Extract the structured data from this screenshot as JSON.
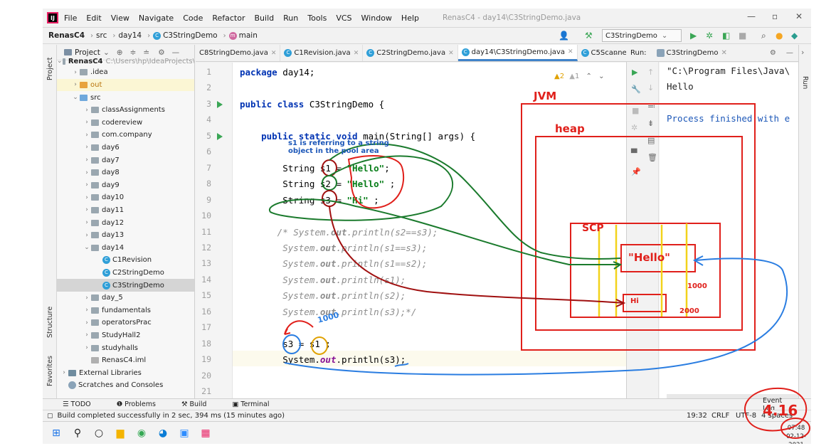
{
  "menu": {
    "items": [
      "File",
      "Edit",
      "View",
      "Navigate",
      "Code",
      "Refactor",
      "Build",
      "Run",
      "Tools",
      "VCS",
      "Window",
      "Help"
    ],
    "window_title": "RenasC4 - day14\\C3StringDemo.java"
  },
  "nav": {
    "project": "RenasC4",
    "crumbs": [
      "src",
      "day14",
      "C3StringDemo",
      "main"
    ],
    "run_config": "C3StringDemo"
  },
  "project_panel": {
    "title": "Project",
    "root": "RenasC4",
    "root_path": "C:\\Users\\hp\\IdeaProjects\\",
    "items": [
      {
        "label": ".idea",
        "kind": "folder",
        "depth": 1,
        "arrow": "›"
      },
      {
        "label": "out",
        "kind": "folder-orange",
        "depth": 1,
        "arrow": "›"
      },
      {
        "label": "src",
        "kind": "folder-blue",
        "depth": 1,
        "arrow": "⌄"
      },
      {
        "label": "classAssignments",
        "kind": "folder",
        "depth": 2,
        "arrow": "›"
      },
      {
        "label": "codereview",
        "kind": "folder",
        "depth": 2,
        "arrow": "›"
      },
      {
        "label": "com.company",
        "kind": "folder",
        "depth": 2,
        "arrow": "›"
      },
      {
        "label": "day6",
        "kind": "folder",
        "depth": 2,
        "arrow": "›"
      },
      {
        "label": "day7",
        "kind": "folder",
        "depth": 2,
        "arrow": "›"
      },
      {
        "label": "day8",
        "kind": "folder",
        "depth": 2,
        "arrow": "›"
      },
      {
        "label": "day9",
        "kind": "folder",
        "depth": 2,
        "arrow": "›"
      },
      {
        "label": "day10",
        "kind": "folder",
        "depth": 2,
        "arrow": "›"
      },
      {
        "label": "day11",
        "kind": "folder",
        "depth": 2,
        "arrow": "›"
      },
      {
        "label": "day12",
        "kind": "folder",
        "depth": 2,
        "arrow": "›"
      },
      {
        "label": "day13",
        "kind": "folder",
        "depth": 2,
        "arrow": "›"
      },
      {
        "label": "day14",
        "kind": "folder",
        "depth": 2,
        "arrow": "⌄"
      },
      {
        "label": "C1Revision",
        "kind": "class",
        "depth": 3,
        "arrow": ""
      },
      {
        "label": "C2StringDemo",
        "kind": "class",
        "depth": 3,
        "arrow": ""
      },
      {
        "label": "C3StringDemo",
        "kind": "class",
        "depth": 3,
        "arrow": "",
        "selected": true
      },
      {
        "label": "day_5",
        "kind": "folder",
        "depth": 2,
        "arrow": "›"
      },
      {
        "label": "fundamentals",
        "kind": "folder",
        "depth": 2,
        "arrow": "›"
      },
      {
        "label": "operatorsPrac",
        "kind": "folder",
        "depth": 2,
        "arrow": "›"
      },
      {
        "label": "StudyHall2",
        "kind": "folder",
        "depth": 2,
        "arrow": "›"
      },
      {
        "label": "studyhalls",
        "kind": "folder",
        "depth": 2,
        "arrow": "›"
      },
      {
        "label": "RenasC4.iml",
        "kind": "file",
        "depth": 2,
        "arrow": ""
      },
      {
        "label": "External Libraries",
        "kind": "lib",
        "depth": 0,
        "arrow": "›"
      },
      {
        "label": "Scratches and Consoles",
        "kind": "scratch",
        "depth": 0,
        "arrow": ""
      }
    ]
  },
  "editor_tabs": [
    {
      "label": "C8StringDemo.java",
      "active": false
    },
    {
      "label": "C1Revision.java",
      "active": false
    },
    {
      "label": "C2StringDemo.java",
      "active": false
    },
    {
      "label": "day14\\C3StringDemo.java",
      "active": true
    },
    {
      "label": "C5ScannerD",
      "active": false
    }
  ],
  "editor": {
    "inspections": {
      "warnings": "2",
      "weak": "1"
    },
    "line_numbers": [
      "1",
      "2",
      "3",
      "4",
      "5",
      "6",
      "7",
      "8",
      "9",
      "10",
      "11",
      "12",
      "13",
      "14",
      "15",
      "16",
      "17",
      "18",
      "19",
      "20",
      "21"
    ],
    "lines": [
      {
        "n": 1,
        "parts": [
          [
            "kw",
            "package"
          ],
          [
            "t",
            " day14;"
          ]
        ]
      },
      {
        "n": 2,
        "parts": []
      },
      {
        "n": 3,
        "parts": [
          [
            "kw",
            "public class"
          ],
          [
            "t",
            " C3StringDemo {"
          ]
        ]
      },
      {
        "n": 4,
        "parts": []
      },
      {
        "n": 5,
        "parts": [
          [
            "t",
            "    "
          ],
          [
            "kw",
            "public static void"
          ],
          [
            "t",
            " main(String[] args) {"
          ]
        ]
      },
      {
        "n": 6,
        "parts": []
      },
      {
        "n": 7,
        "parts": [
          [
            "t",
            "        String s1 = "
          ],
          [
            "str",
            "\"Hello\""
          ],
          [
            "t",
            ";"
          ]
        ]
      },
      {
        "n": 8,
        "parts": [
          [
            "t",
            "        String s2 = "
          ],
          [
            "str",
            "\"Hello\""
          ],
          [
            "t",
            " ;"
          ]
        ]
      },
      {
        "n": 9,
        "parts": [
          [
            "t",
            "        String s3 = "
          ],
          [
            "str",
            "\"Hi\""
          ],
          [
            "t",
            " ;"
          ]
        ]
      },
      {
        "n": 10,
        "parts": []
      },
      {
        "n": 11,
        "parts": [
          [
            "cm",
            "       /* System."
          ],
          [
            "cmf",
            "out"
          ],
          [
            "cm",
            ".println(s2==s3);"
          ]
        ]
      },
      {
        "n": 12,
        "parts": [
          [
            "cm",
            "        System."
          ],
          [
            "cmf",
            "out"
          ],
          [
            "cm",
            ".println(s1==s3);"
          ]
        ]
      },
      {
        "n": 13,
        "parts": [
          [
            "cm",
            "        System."
          ],
          [
            "cmf",
            "out"
          ],
          [
            "cm",
            ".println(s1==s2);"
          ]
        ]
      },
      {
        "n": 14,
        "parts": [
          [
            "cm",
            "        System."
          ],
          [
            "cmf",
            "out"
          ],
          [
            "cm",
            ".println(s1);"
          ]
        ]
      },
      {
        "n": 15,
        "parts": [
          [
            "cm",
            "        System."
          ],
          [
            "cmf",
            "out"
          ],
          [
            "cm",
            ".println(s2);"
          ]
        ]
      },
      {
        "n": 16,
        "parts": [
          [
            "cm",
            "        System."
          ],
          [
            "cmf",
            "out"
          ],
          [
            "cm",
            ".println(s3);*/"
          ]
        ]
      },
      {
        "n": 17,
        "parts": []
      },
      {
        "n": 18,
        "parts": [
          [
            "t",
            "        s3 = s1 ;"
          ]
        ]
      },
      {
        "n": 19,
        "parts": [
          [
            "t",
            "        System."
          ],
          [
            "fld",
            "out"
          ],
          [
            "t",
            ".println(s3);"
          ]
        ]
      },
      {
        "n": 20,
        "parts": []
      },
      {
        "n": 21,
        "parts": []
      }
    ]
  },
  "run_panel": {
    "label": "Run:",
    "tab": "C3StringDemo",
    "output": [
      "\"C:\\Program Files\\Java\\",
      "Hello",
      "",
      "Process finished with e"
    ]
  },
  "side_labels": {
    "project": "Project",
    "structure": "Structure",
    "favorites": "Favorites",
    "run": "Run"
  },
  "bottom_tools": [
    "TODO",
    "Problems",
    "Build",
    "Terminal"
  ],
  "event_log": "Event Log",
  "status": {
    "message": "Build completed successfully in 2 sec, 394 ms (15 minutes ago)",
    "position": "19:32",
    "line_sep": "CRLF",
    "encoding": "UTF-8",
    "indent": "4 spaces"
  },
  "taskbar": {
    "time": "07:48",
    "date": "02-12-2021"
  },
  "annotations": {
    "jvm": "JVM",
    "heap": "heap",
    "scp": "SCP",
    "hello": "\"Hello\"",
    "hi": "Hi",
    "note": "s1 is referring to a string",
    "note2": "object in the pool area",
    "addr1": "1000",
    "addr2": "1000",
    "addr3": "2000",
    "score": "4.16",
    "colors": {
      "red": "#e0201b",
      "green": "#1a7a2c",
      "darkred": "#a01010",
      "blue": "#2a7de1",
      "yellow": "#f2d21b"
    }
  }
}
